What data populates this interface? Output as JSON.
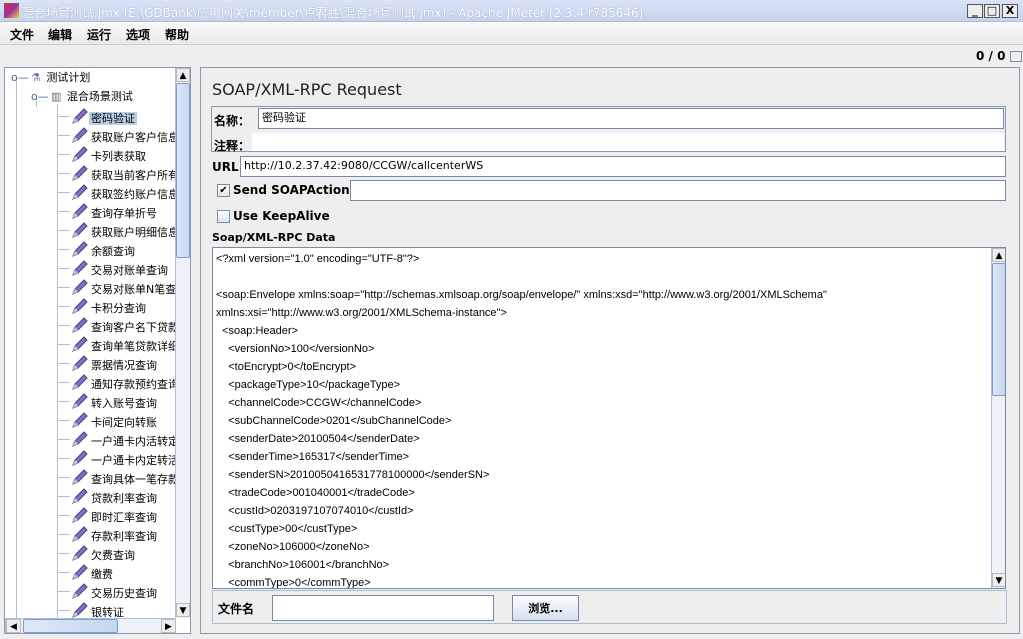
{
  "window": {
    "title": "混合场景测试.jmx (E:\\GDBank\\应用网关\\member\\卢君胜\\混合场景测试.jmx) - Apache JMeter (2.3.4 r785646)",
    "minimize": "_",
    "maximize": "□",
    "close": "X"
  },
  "menu": [
    "文件",
    "编辑",
    "运行",
    "选项",
    "帮助"
  ],
  "status": {
    "counter": "0 / 0"
  },
  "tree": {
    "root": "测试计划",
    "group": "混合场景测试",
    "items": [
      "密码验证",
      "获取账户客户信息",
      "卡列表获取",
      "获取当前客户所有",
      "获取签约账户信息",
      "查询存单折号",
      "获取账户明细信息",
      "余额查询",
      "交易对账单查询",
      "交易对账单N笔查",
      "卡积分查询",
      "查询客户名下贷款",
      "查询单笔贷款详细",
      "票据情况查询",
      "通知存款预约查询",
      "转入账号查询",
      "卡间定向转账",
      "一户通卡内活转定",
      "一户通卡内定转活",
      "查询具体一笔存款",
      "贷款利率查询",
      "即时汇率查询",
      "存款利率查询",
      "欠费查询",
      "缴费",
      "交易历史查询",
      "银转证"
    ],
    "selected": 0
  },
  "editor": {
    "title": "SOAP/XML-RPC Request",
    "name_label": "名称：",
    "name_value": "密码验证",
    "comment_label": "注释：",
    "comment_value": "",
    "url_label": "URL",
    "url_value": "http://10.2.37.42:9080/CCGW/callcenterWS",
    "send_soapaction_label": "Send SOAPAction:",
    "send_soapaction_checked": true,
    "soapaction_value": "",
    "keepalive_label": "Use KeepAlive",
    "keepalive_checked": false,
    "data_label": "Soap/XML-RPC Data",
    "xml_lines": [
      "<?xml version=\"1.0\" encoding=\"UTF-8\"?>",
      "",
      "<soap:Envelope xmlns:soap=\"http://schemas.xmlsoap.org/soap/envelope/\" xmlns:xsd=\"http://www.w3.org/2001/XMLSchema\"",
      "xmlns:xsi=\"http://www.w3.org/2001/XMLSchema-instance\">",
      "  <soap:Header>",
      "    <versionNo>100</versionNo>",
      "    <toEncrypt>0</toEncrypt>",
      "    <packageType>10</packageType>",
      "    <channelCode>CCGW</channelCode>",
      "    <subChannelCode>0201</subChannelCode>",
      "    <senderDate>20100504</senderDate>",
      "    <senderTime>165317</senderTime>",
      "    <senderSN>2010050416531778100000</senderSN>",
      "    <tradeCode>001040001</tradeCode>",
      "    <custId>0203197107074010</custId>",
      "    <custType>00</custType>",
      "    <zoneNo>106000</zoneNo>",
      "    <branchNo>106001</branchNo>",
      "    <commType>0</commType>"
    ],
    "file_label": "文件名",
    "file_value": "",
    "browse_label": "浏览..."
  }
}
